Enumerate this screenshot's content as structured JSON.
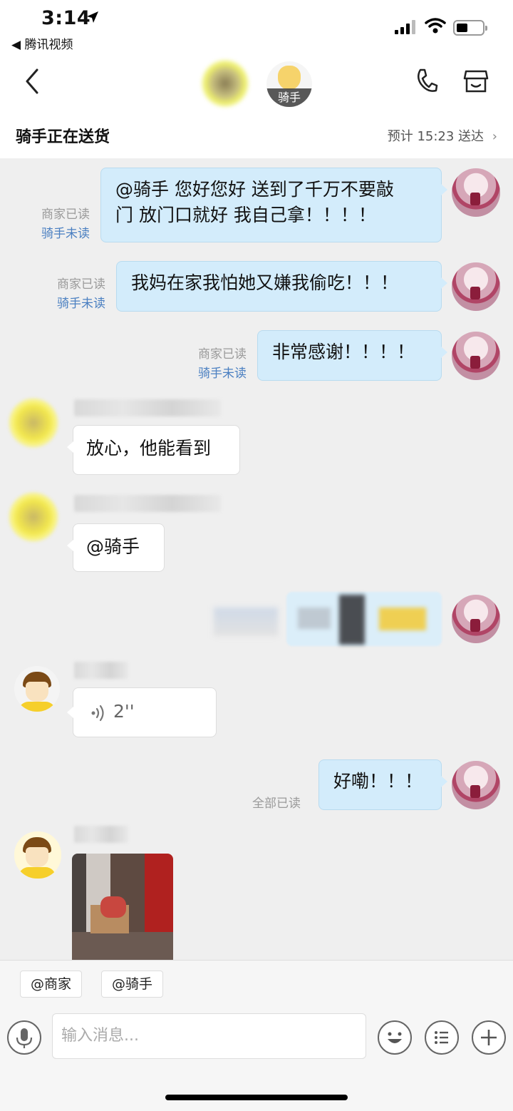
{
  "status_bar": {
    "time": "3:14",
    "back_app": "◀ 腾讯视频"
  },
  "nav": {
    "rider_label": "骑手"
  },
  "delivery": {
    "title": "骑手正在送货",
    "eta": "预计 15:23 送达",
    "chevron": "›"
  },
  "messages": {
    "m1": {
      "line1": "@骑手 您好您好 送到了千万不要敲",
      "line2": "门 放门口就好 我自己拿！！！！",
      "merchant_status": "商家已读",
      "rider_status": "骑手未读"
    },
    "m2": {
      "text": "我妈在家我怕她又嫌我偷吃！！！",
      "merchant_status": "商家已读",
      "rider_status": "骑手未读"
    },
    "m3": {
      "text": "非常感谢！！！！",
      "merchant_status": "商家已读",
      "rider_status": "骑手未读"
    },
    "m4": {
      "text": "放心，他能看到"
    },
    "m5": {
      "text": "@骑手"
    },
    "m7": {
      "duration": "2''"
    },
    "m8": {
      "text": "好嘞！！！",
      "status": "全部已读"
    }
  },
  "quick_mentions": {
    "merchant": "@商家",
    "rider": "@骑手"
  },
  "input": {
    "placeholder": "输入消息..."
  },
  "icons": [
    "back-icon",
    "phone-icon",
    "shop-icon",
    "voice-icon",
    "microphone-icon",
    "emoji-icon",
    "menu-icon",
    "plus-icon"
  ]
}
